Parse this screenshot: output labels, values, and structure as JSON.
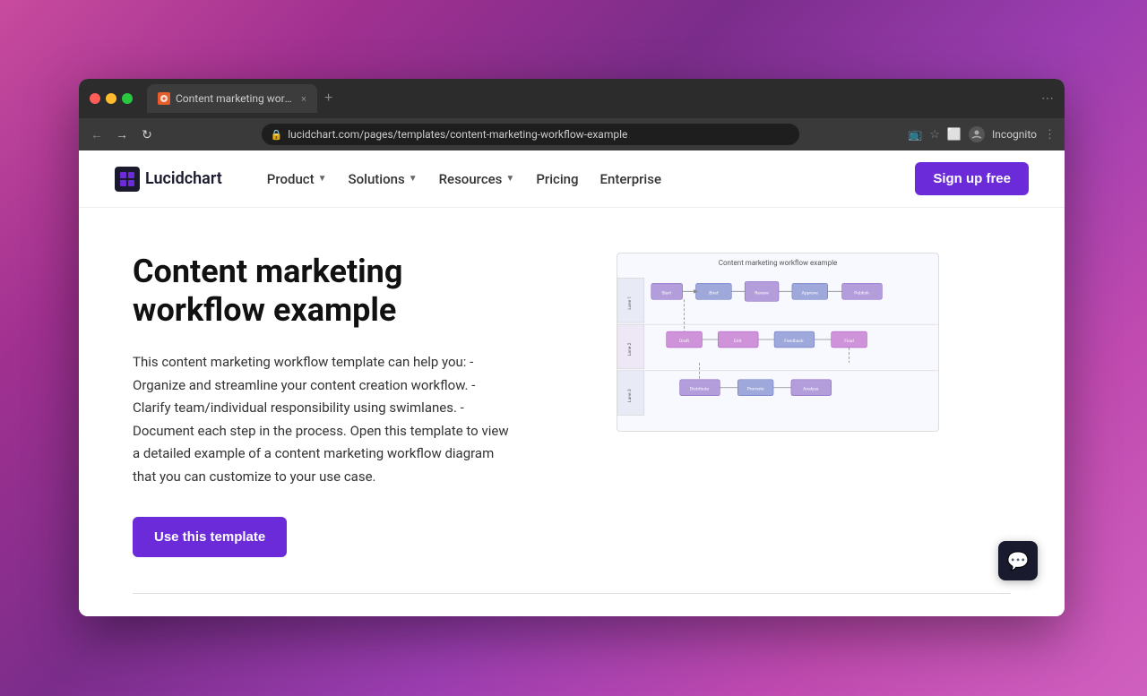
{
  "desktop": {
    "bg_colors": [
      "#c84b9e",
      "#a03090",
      "#7b2d8b"
    ]
  },
  "browser": {
    "tab": {
      "favicon_text": "L",
      "title": "Content marketing workflow e...",
      "close_label": "×"
    },
    "new_tab_label": "+",
    "more_label": "⋯",
    "address_bar": {
      "url": "lucidchart.com/pages/templates/content-marketing-workflow-example",
      "lock_icon": "🔒"
    },
    "nav_buttons": {
      "back": "←",
      "forward": "→",
      "refresh": "↻"
    },
    "incognito_label": "Incognito"
  },
  "navbar": {
    "logo_text": "Lucidchart",
    "links": [
      {
        "label": "Product",
        "has_dropdown": true
      },
      {
        "label": "Solutions",
        "has_dropdown": true
      },
      {
        "label": "Resources",
        "has_dropdown": true
      },
      {
        "label": "Pricing",
        "has_dropdown": false
      },
      {
        "label": "Enterprise",
        "has_dropdown": false
      }
    ],
    "cta_label": "Sign up free"
  },
  "hero": {
    "title": "Content marketing workflow example",
    "description": "This content marketing workflow template can help you: - Organize and streamline your content creation workflow. - Clarify team/individual responsibility using swimlanes. - Document each step in the process. Open this template to view a detailed example of a content marketing workflow diagram that you can customize to your use case.",
    "use_template_label": "Use this template",
    "diagram_title": "Content marketing workflow example"
  },
  "chat_widget": {
    "icon": "💬"
  }
}
